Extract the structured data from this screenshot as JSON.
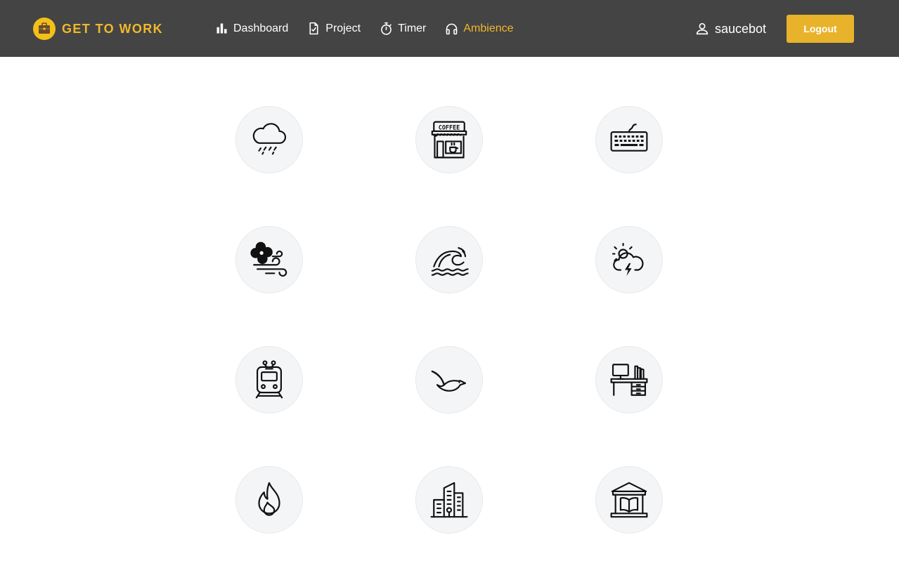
{
  "brand": {
    "name": "GET TO WORK",
    "icon": "briefcase-icon"
  },
  "nav": [
    {
      "label": "Dashboard",
      "icon": "bar-chart-icon",
      "active": false
    },
    {
      "label": "Project",
      "icon": "clipboard-check-icon",
      "active": false
    },
    {
      "label": "Timer",
      "icon": "stopwatch-icon",
      "active": false
    },
    {
      "label": "Ambience",
      "icon": "headphones-icon",
      "active": true
    }
  ],
  "user": {
    "name": "saucebot",
    "icon": "user-icon"
  },
  "logout_label": "Logout",
  "colors": {
    "navbar": "#444444",
    "accent": "#f0b82a",
    "button": "#e8b32a",
    "tile": "#f4f5f7"
  },
  "sounds": [
    {
      "icon": "rain-cloud-icon"
    },
    {
      "icon": "coffee-shop-icon"
    },
    {
      "icon": "keyboard-icon"
    },
    {
      "icon": "fan-wind-icon"
    },
    {
      "icon": "ocean-wave-icon"
    },
    {
      "icon": "thunderstorm-icon"
    },
    {
      "icon": "train-icon"
    },
    {
      "icon": "bird-icon"
    },
    {
      "icon": "office-desk-icon"
    },
    {
      "icon": "fire-icon"
    },
    {
      "icon": "city-buildings-icon"
    },
    {
      "icon": "library-icon"
    }
  ]
}
